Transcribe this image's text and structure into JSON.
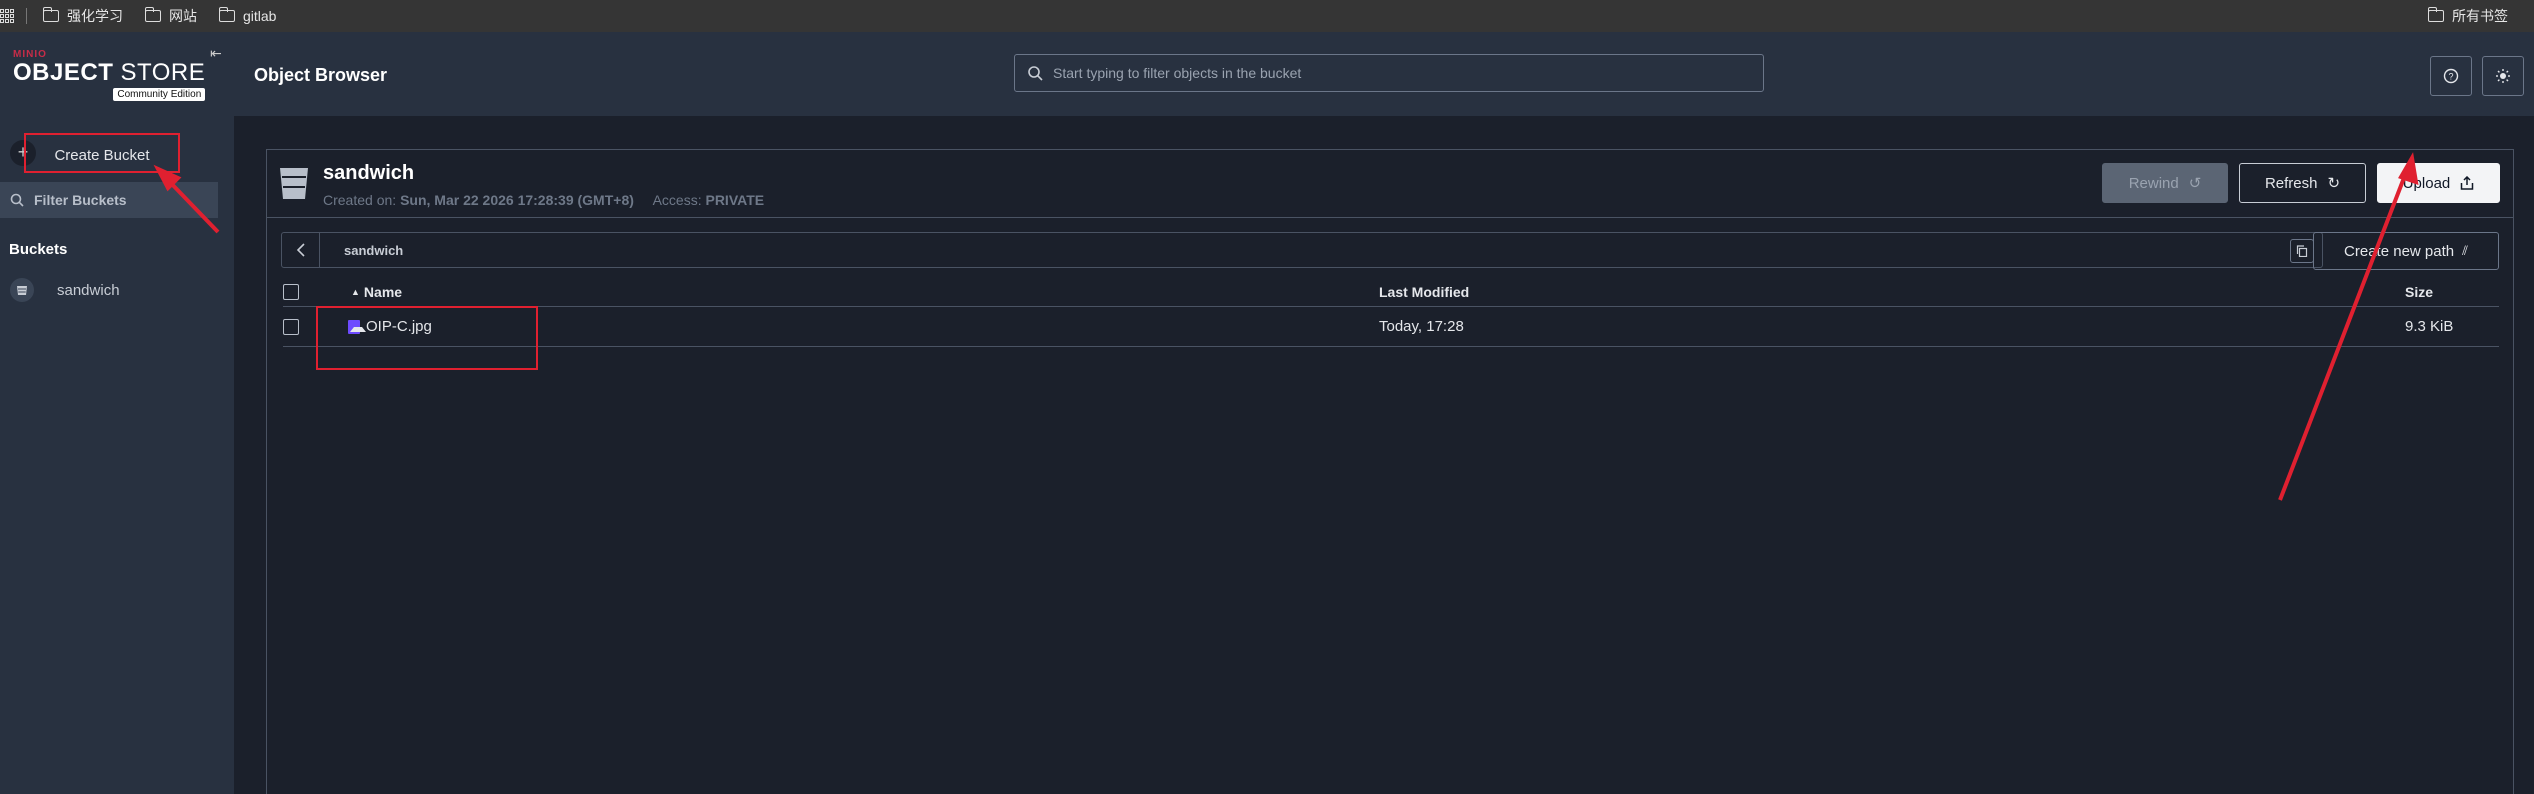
{
  "bookmarks": {
    "items": [
      {
        "label": "强化学习"
      },
      {
        "label": "网站"
      },
      {
        "label": "gitlab"
      }
    ],
    "all_bookmarks": "所有书签"
  },
  "sidebar": {
    "logo_brand": "MINIO",
    "logo_title_bold": "OBJECT",
    "logo_title_rest": "STORE",
    "logo_edition": "Community Edition",
    "create_bucket_label": "Create Bucket",
    "filter_placeholder": "Filter Buckets",
    "buckets_title": "Buckets",
    "buckets": [
      {
        "label": "sandwich"
      }
    ]
  },
  "header": {
    "title": "Object Browser",
    "search_placeholder": "Start typing to filter objects in the bucket",
    "help_icon": "help-icon",
    "theme_icon": "sun-icon"
  },
  "bucket": {
    "name": "sandwich",
    "created_label": "Created on:",
    "created_value": "Sun, Mar 22 2026 17:28:39 (GMT+8)",
    "access_label": "Access:",
    "access_value": "PRIVATE",
    "rewind_label": "Rewind",
    "refresh_label": "Refresh",
    "upload_label": "Upload",
    "path": "sandwich",
    "create_path_label": "Create new path"
  },
  "table": {
    "columns": {
      "name": "Name",
      "modified": "Last Modified",
      "size": "Size"
    },
    "sort_indicator": "▲",
    "rows": [
      {
        "name": "OIP-C.jpg",
        "modified": "Today, 17:28",
        "size": "9.3 KiB"
      }
    ]
  },
  "annotations": {
    "color": "#e02030"
  }
}
